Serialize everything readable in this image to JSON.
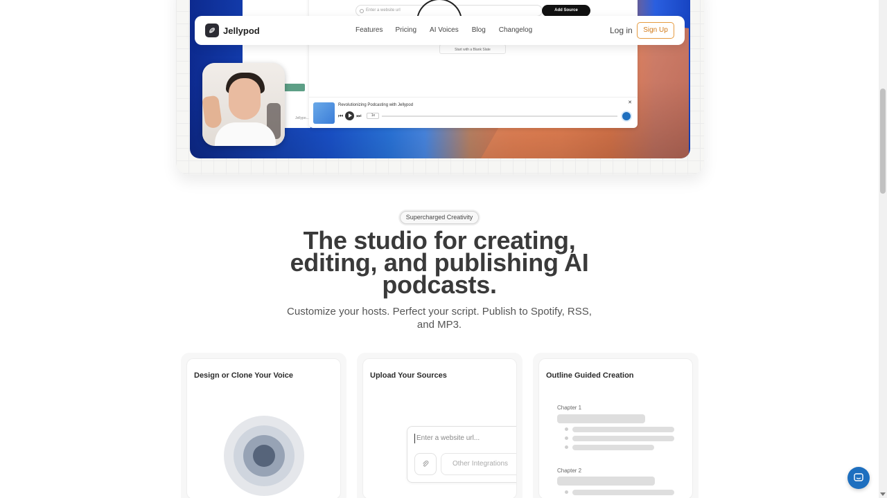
{
  "navbar": {
    "brand": "Jellypod",
    "links": [
      "Features",
      "Pricing",
      "AI Voices",
      "Blog",
      "Changelog"
    ],
    "login": "Log in",
    "signup": "Sign Up"
  },
  "demo": {
    "url_placeholder": "Enter a website url",
    "add_source": "Add Source",
    "blank_state": "Start with a Blank Slate",
    "player_title": "Revolutionizing Podcasting with Jellypod",
    "speed": "1x",
    "left_snippet": "Jellypo..."
  },
  "section": {
    "badge": "Supercharged Creativity",
    "headline": "The studio for creating, editing, and publishing AI podcasts.",
    "subhead": "Customize your hosts. Perfect your script. Publish to Spotify, RSS, and MP3."
  },
  "cards": [
    {
      "title": "Design or Clone Your Voice"
    },
    {
      "title": "Upload Your Sources",
      "input_placeholder": "Enter a website url...",
      "integrations_label": "Other Integrations"
    },
    {
      "title": "Outline Guided Creation",
      "chapters": [
        "Chapter 1",
        "Chapter 2"
      ]
    }
  ],
  "colors": {
    "accent": "#e59a3e",
    "brand_dark": "#2b2b33",
    "chat_blue": "#1e6fbf"
  },
  "icons": {
    "logo": "jellypod-logo-icon",
    "chat": "chat-bubble-icon",
    "clip": "paperclip-icon"
  }
}
